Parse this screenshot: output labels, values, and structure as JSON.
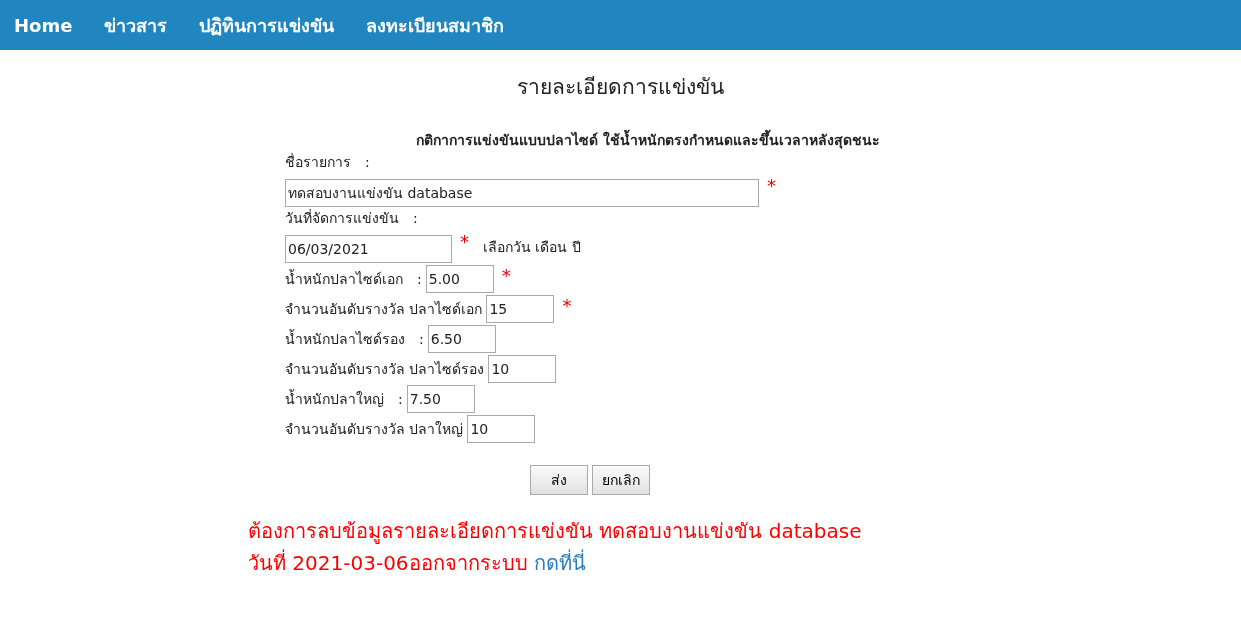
{
  "nav": [
    {
      "label": "Home"
    },
    {
      "label": "ข่าวสาร"
    },
    {
      "label": "ปฏิทินการแข่งขัน"
    },
    {
      "label": "ลงทะเบียนสมาชิก"
    }
  ],
  "title": "รายละเอียดการแข่งขัน",
  "rule_text": "กติกาการแข่งขันแบบปลาไซด์ ใช้น้ำหนักตรงกำหนดและขึ้นเวลาหลังสุดชนะ",
  "fields": [
    {
      "kind": "stacked",
      "label": "ชื่อรายการ",
      "colon": ":",
      "value": "ทดสอบงานแข่งขัน database",
      "required_mark": "*"
    },
    {
      "kind": "stacked",
      "label": "วันที่จัดการแข่งขัน",
      "colon": ":",
      "value": "06/03/2021",
      "required_mark": "*",
      "hint": "เลือกวัน เดือน ปี"
    },
    {
      "kind": "inline",
      "label": "น้ำหนักปลาไซด์เอก",
      "colon": ":",
      "value": "5.00",
      "required_mark": "*"
    },
    {
      "kind": "inline",
      "label": "จำนวนอันดับรางวัล ปลาไซด์เอก",
      "value": "15",
      "required_mark": "*"
    },
    {
      "kind": "inline",
      "label": "น้ำหนักปลาไซด์รอง",
      "colon": ":",
      "value": "6.50"
    },
    {
      "kind": "inline",
      "label": "จำนวนอันดับรางวัล ปลาไซด์รอง",
      "value": "10"
    },
    {
      "kind": "inline",
      "label": "น้ำหนักปลาใหญ่",
      "colon": ":",
      "value": "7.50"
    },
    {
      "kind": "inline",
      "label": "จำนวนอันดับรางวัล ปลาใหญ่",
      "value": "10"
    }
  ],
  "buttons": [
    {
      "label": "ส่ง"
    },
    {
      "label": "ยกเลิก"
    }
  ],
  "message": {
    "line_1": "ต้องการลบข้อมูลรายละเอียดการแข่งขัน ทดสอบงานแข่งขัน database",
    "line_2": "วันที่ 2021-03-06ออกจากระบบ",
    "link": "กดที่นี่"
  }
}
